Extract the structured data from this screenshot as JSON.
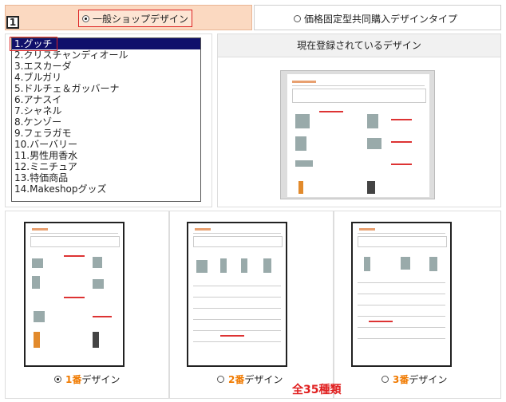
{
  "step_number": "1",
  "tabs": [
    {
      "label": "一般ショップデザイン",
      "selected": true
    },
    {
      "label": "価格固定型共同購入デザインタイプ",
      "selected": false
    }
  ],
  "design_list": [
    "1.グッチ",
    "2.クリスチャンディオール",
    "3.エスカーダ",
    "4.ブルガリ",
    "5.ドルチェ＆ガッバーナ",
    "6.アナスイ",
    "7.シャネル",
    "8.ケンゾー",
    "9.フェラガモ",
    "10.バーバリー",
    "11.男性用香水",
    "12.ミニチュア",
    "13.特価商品",
    "14.Makeshopグッズ"
  ],
  "selected_index": 0,
  "current_design_heading": "現在登録されているデザイン",
  "design_options": [
    {
      "number": "1番",
      "suffix": "デザイン",
      "selected": true
    },
    {
      "number": "2番",
      "suffix": "デザイン",
      "selected": false
    },
    {
      "number": "3番",
      "suffix": "デザイン",
      "selected": false
    }
  ],
  "total_label": "全35種類",
  "colors": {
    "tab_active_bg": "#fbd9c1",
    "list_selected_bg": "#10106b",
    "accent_orange": "#f07a00",
    "total_red": "#e02020"
  }
}
